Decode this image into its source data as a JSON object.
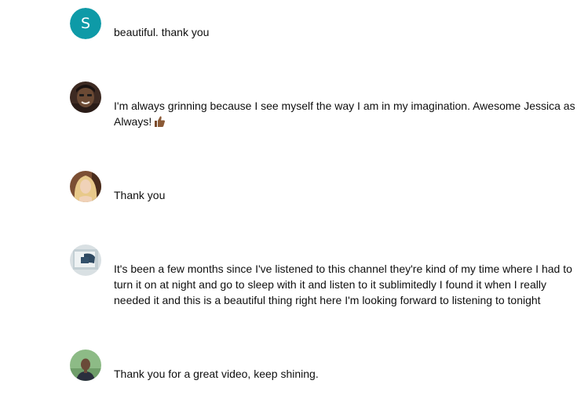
{
  "colors": {
    "avatar_s_bg": "#0e9aa7",
    "text": "#0f0f0f"
  },
  "comments": [
    {
      "avatar": {
        "type": "letter",
        "letter": "S"
      },
      "text": "beautiful.  thank you"
    },
    {
      "avatar": {
        "type": "photo",
        "icon": "user-photo-icon"
      },
      "text": "I'm always grinning because I see myself the way I am in my imagination. Awesome Jessica as Always!",
      "emoji": "thumbs-up-icon"
    },
    {
      "avatar": {
        "type": "photo",
        "icon": "user-photo-icon"
      },
      "text": "Thank you"
    },
    {
      "avatar": {
        "type": "photo",
        "icon": "user-photo-icon"
      },
      "text": "It's been a few months since I've listened to this channel they're kind of my time where I had to turn it on at night and go to sleep with it and listen to it sublimitedly I found it when I really needed it and this is a beautiful thing right here I'm looking forward to listening to tonight"
    },
    {
      "avatar": {
        "type": "photo",
        "icon": "user-photo-icon"
      },
      "text": "Thank you for a great video, keep shining."
    }
  ]
}
